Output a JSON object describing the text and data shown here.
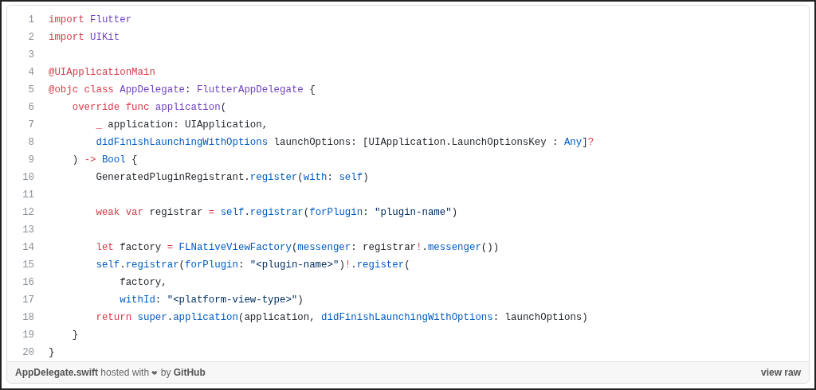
{
  "code_lines": [
    {
      "number": "1",
      "tokens": [
        {
          "kind": "keyword",
          "text": "import"
        },
        {
          "kind": "entity",
          "text": " Flutter"
        }
      ]
    },
    {
      "number": "2",
      "tokens": [
        {
          "kind": "keyword",
          "text": "import"
        },
        {
          "kind": "entity",
          "text": " UIKit"
        }
      ]
    },
    {
      "number": "3"
    },
    {
      "number": "4",
      "tokens": [
        {
          "kind": "keyword",
          "text": "@UIApplicationMain"
        }
      ]
    },
    {
      "number": "5",
      "tokens": [
        {
          "kind": "keyword",
          "text": "@objc"
        },
        {
          "kind": "keyword",
          "text": " class"
        },
        {
          "kind": "entity",
          "text": " AppDelegate"
        },
        {
          "kind": "plain",
          "text": ": "
        },
        {
          "kind": "entity",
          "text": "FlutterAppDelegate"
        },
        {
          "kind": "plain",
          "text": " {"
        }
      ]
    },
    {
      "number": "6",
      "tokens": [
        {
          "kind": "keyword",
          "text": "    override"
        },
        {
          "kind": "keyword",
          "text": " func"
        },
        {
          "kind": "entity",
          "text": " application"
        },
        {
          "kind": "plain",
          "text": "("
        }
      ]
    },
    {
      "number": "7",
      "tokens": [
        {
          "kind": "keyword",
          "text": "        _"
        },
        {
          "kind": "plain",
          "text": " application: UIApplication,"
        }
      ]
    },
    {
      "number": "8",
      "tokens": [
        {
          "kind": "constant",
          "text": "        didFinishLaunchingWithOptions"
        },
        {
          "kind": "plain",
          "text": " launchOptions: [UIApplication.LaunchOptionsKey : "
        },
        {
          "kind": "constant",
          "text": "Any"
        },
        {
          "kind": "plain",
          "text": "]"
        },
        {
          "kind": "keyword",
          "text": "?"
        }
      ]
    },
    {
      "number": "9",
      "tokens": [
        {
          "kind": "plain",
          "text": "    ) "
        },
        {
          "kind": "keyword",
          "text": "->"
        },
        {
          "kind": "constant",
          "text": " Bool"
        },
        {
          "kind": "plain",
          "text": " {"
        }
      ]
    },
    {
      "number": "10",
      "tokens": [
        {
          "kind": "plain",
          "text": "        GeneratedPluginRegistrant."
        },
        {
          "kind": "constant",
          "text": "register"
        },
        {
          "kind": "plain",
          "text": "("
        },
        {
          "kind": "constant",
          "text": "with"
        },
        {
          "kind": "plain",
          "text": ": "
        },
        {
          "kind": "constant",
          "text": "self"
        },
        {
          "kind": "plain",
          "text": ")"
        }
      ]
    },
    {
      "number": "11"
    },
    {
      "number": "12",
      "tokens": [
        {
          "kind": "keyword",
          "text": "        weak"
        },
        {
          "kind": "keyword",
          "text": " var"
        },
        {
          "kind": "plain",
          "text": " registrar "
        },
        {
          "kind": "keyword",
          "text": "="
        },
        {
          "kind": "constant",
          "text": " self"
        },
        {
          "kind": "plain",
          "text": "."
        },
        {
          "kind": "constant",
          "text": "registrar"
        },
        {
          "kind": "plain",
          "text": "("
        },
        {
          "kind": "constant",
          "text": "forPlugin"
        },
        {
          "kind": "plain",
          "text": ": "
        },
        {
          "kind": "string",
          "text": "\"plugin-name\""
        },
        {
          "kind": "plain",
          "text": ")"
        }
      ]
    },
    {
      "number": "13"
    },
    {
      "number": "14",
      "tokens": [
        {
          "kind": "keyword",
          "text": "        let"
        },
        {
          "kind": "plain",
          "text": " factory "
        },
        {
          "kind": "keyword",
          "text": "="
        },
        {
          "kind": "constant",
          "text": " FLNativeViewFactory"
        },
        {
          "kind": "plain",
          "text": "("
        },
        {
          "kind": "constant",
          "text": "messenger"
        },
        {
          "kind": "plain",
          "text": ": registrar"
        },
        {
          "kind": "keyword",
          "text": "!"
        },
        {
          "kind": "plain",
          "text": "."
        },
        {
          "kind": "constant",
          "text": "messenger"
        },
        {
          "kind": "plain",
          "text": "())"
        }
      ]
    },
    {
      "number": "15",
      "tokens": [
        {
          "kind": "constant",
          "text": "        self"
        },
        {
          "kind": "plain",
          "text": "."
        },
        {
          "kind": "constant",
          "text": "registrar"
        },
        {
          "kind": "plain",
          "text": "("
        },
        {
          "kind": "constant",
          "text": "forPlugin"
        },
        {
          "kind": "plain",
          "text": ": "
        },
        {
          "kind": "string",
          "text": "\"<plugin-name>\""
        },
        {
          "kind": "plain",
          "text": ")"
        },
        {
          "kind": "keyword",
          "text": "!"
        },
        {
          "kind": "plain",
          "text": "."
        },
        {
          "kind": "constant",
          "text": "register"
        },
        {
          "kind": "plain",
          "text": "("
        }
      ]
    },
    {
      "number": "16",
      "tokens": [
        {
          "kind": "plain",
          "text": "            factory,"
        }
      ]
    },
    {
      "number": "17",
      "tokens": [
        {
          "kind": "constant",
          "text": "            withId"
        },
        {
          "kind": "plain",
          "text": ": "
        },
        {
          "kind": "string",
          "text": "\"<platform-view-type>\""
        },
        {
          "kind": "plain",
          "text": ")"
        }
      ]
    },
    {
      "number": "18",
      "tokens": [
        {
          "kind": "keyword",
          "text": "        return"
        },
        {
          "kind": "constant",
          "text": " super"
        },
        {
          "kind": "plain",
          "text": "."
        },
        {
          "kind": "constant",
          "text": "application"
        },
        {
          "kind": "plain",
          "text": "(application, "
        },
        {
          "kind": "constant",
          "text": "didFinishLaunchingWithOptions"
        },
        {
          "kind": "plain",
          "text": ": launchOptions)"
        }
      ]
    },
    {
      "number": "19",
      "tokens": [
        {
          "kind": "plain",
          "text": "    }"
        }
      ]
    },
    {
      "number": "20",
      "tokens": [
        {
          "kind": "plain",
          "text": "}"
        }
      ]
    }
  ],
  "footer": {
    "file_link": "AppDelegate.swift",
    "hosted_text": "hosted with",
    "heart": "❤",
    "by_text": "by",
    "host_link": "GitHub",
    "view_raw": "view raw"
  }
}
